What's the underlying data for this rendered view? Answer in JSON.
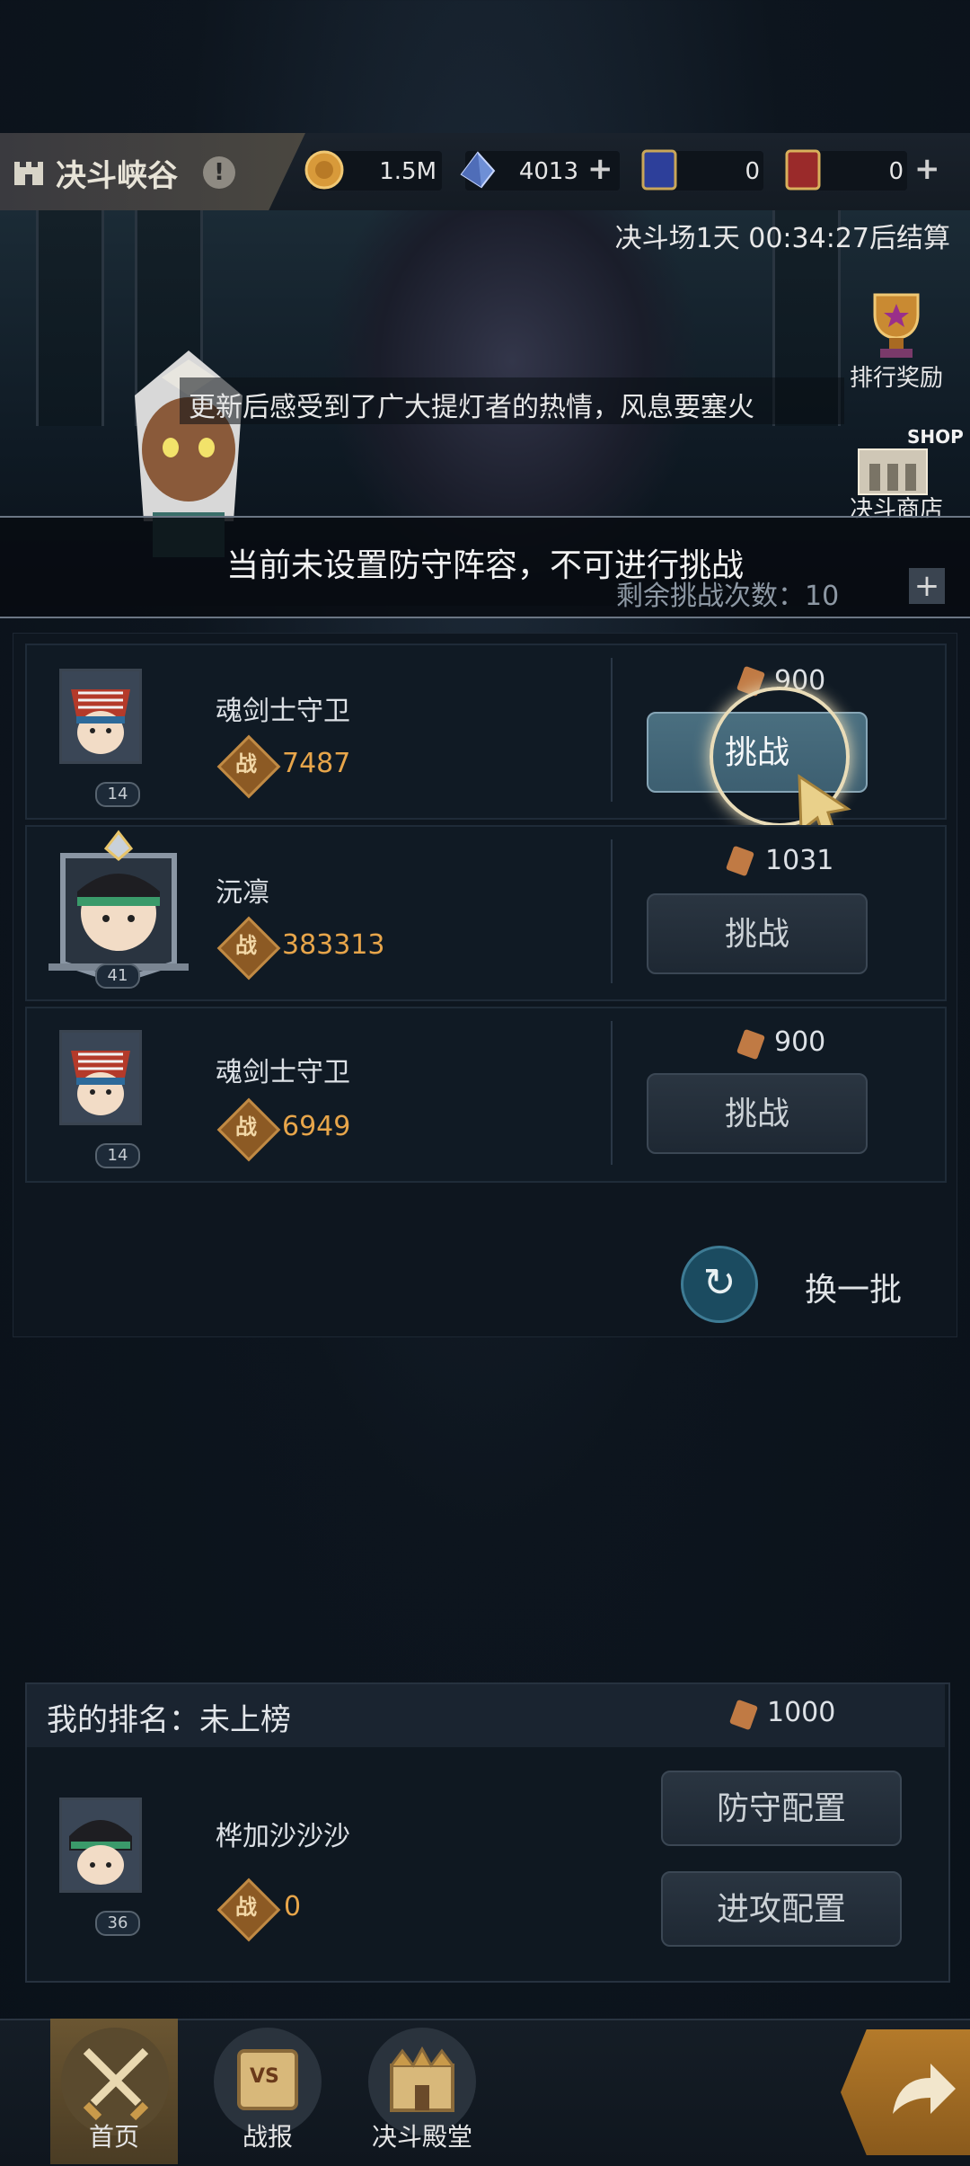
{
  "header": {
    "title": "决斗峡谷",
    "coins": "1.5M",
    "gems": "4013",
    "ticket_a": "0",
    "ticket_b": "0",
    "timer": "决斗场1天 00:34:27后结算"
  },
  "side": {
    "rank_rewards": "排行奖励",
    "shop": "决斗商店",
    "shop_badge": "SHOP"
  },
  "speech": "更新后感受到了广大提灯者的热情，风息要塞火",
  "notice": "当前未设置防守阵容，不可进行挑战",
  "remaining_label": "剩余挑战次数：10",
  "opponents": [
    {
      "name": "魂剑士守卫",
      "level": "14",
      "power": "7487",
      "cost": "900",
      "button": "挑战"
    },
    {
      "name": "沅凛",
      "level": "41",
      "power": "383313",
      "cost": "1031",
      "button": "挑战"
    },
    {
      "name": "魂剑士守卫",
      "level": "14",
      "power": "6949",
      "cost": "900",
      "button": "挑战"
    }
  ],
  "power_glyph": "战",
  "refresh_label": "换一批",
  "me": {
    "rank": "我的排名：未上榜",
    "cost": "1000",
    "name": "桦加沙沙沙",
    "level": "36",
    "power": "0",
    "defense_btn": "防守配置",
    "attack_btn": "进攻配置"
  },
  "nav": {
    "home": "首页",
    "report": "战报",
    "hall": "决斗殿堂",
    "vs_badge": "VS"
  },
  "colors": {
    "accent_gold": "#e7a54a",
    "highlight_button": "#4a6f80",
    "background": "#0d151e"
  }
}
